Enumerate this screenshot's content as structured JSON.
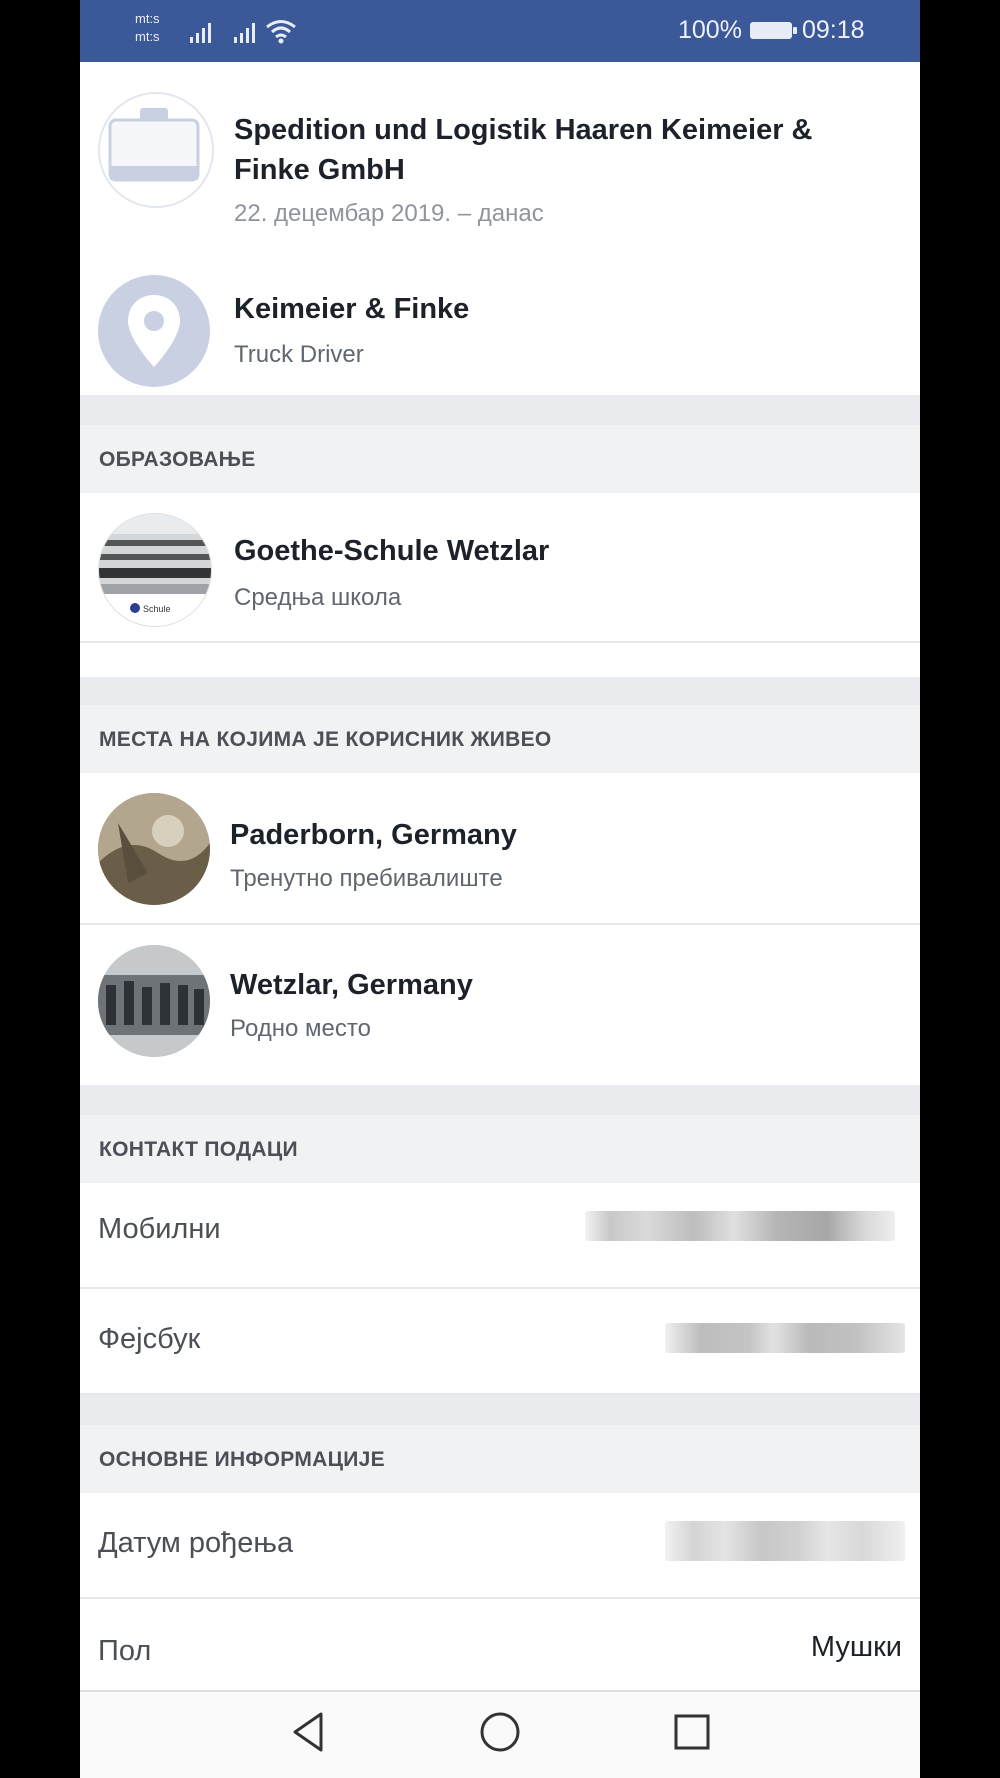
{
  "status_bar": {
    "carrier_1": "mt:s",
    "carrier_2": "mt:s",
    "battery": "100%",
    "time": "09:18"
  },
  "work": [
    {
      "title_line1": "Spedition und Logistik Haaren Keimeier &",
      "title_line2": "Finke GmbH",
      "subtitle": "22. децембар 2019. – данас",
      "icon": "briefcase-icon"
    },
    {
      "title": "Keimeier & Finke",
      "subtitle": "Truck Driver",
      "icon": "location-pin-icon"
    }
  ],
  "education": {
    "header": "ОБРАЗОВАЊЕ",
    "school": "Goethe-Schule Wetzlar",
    "type": "Средња школа",
    "thumb_caption": "Schule"
  },
  "places": {
    "header": "МЕСТА НА КОЈИМА ЈЕ КОРИСНИК ЖИВЕО",
    "items": [
      {
        "title": "Paderborn, Germany",
        "subtitle": "Тренутно пребивалиште"
      },
      {
        "title": "Wetzlar, Germany",
        "subtitle": "Родно место"
      }
    ]
  },
  "contact": {
    "header": "КОНТАКТ ПОДАЦИ",
    "mobile_label": "Мобилни",
    "facebook_label": "Фејсбук"
  },
  "basic_info": {
    "header": "ОСНОВНЕ ИНФОРМАЦИЈЕ",
    "birthday_label": "Датум рођења",
    "gender_label": "Пол",
    "gender_value": "Мушки"
  },
  "nav": [
    "back-icon",
    "home-icon",
    "recents-icon"
  ],
  "colors": {
    "statusbar": "#3b5998",
    "section_bg": "#f1f2f4",
    "icon_bg": "#c9d0e1"
  }
}
